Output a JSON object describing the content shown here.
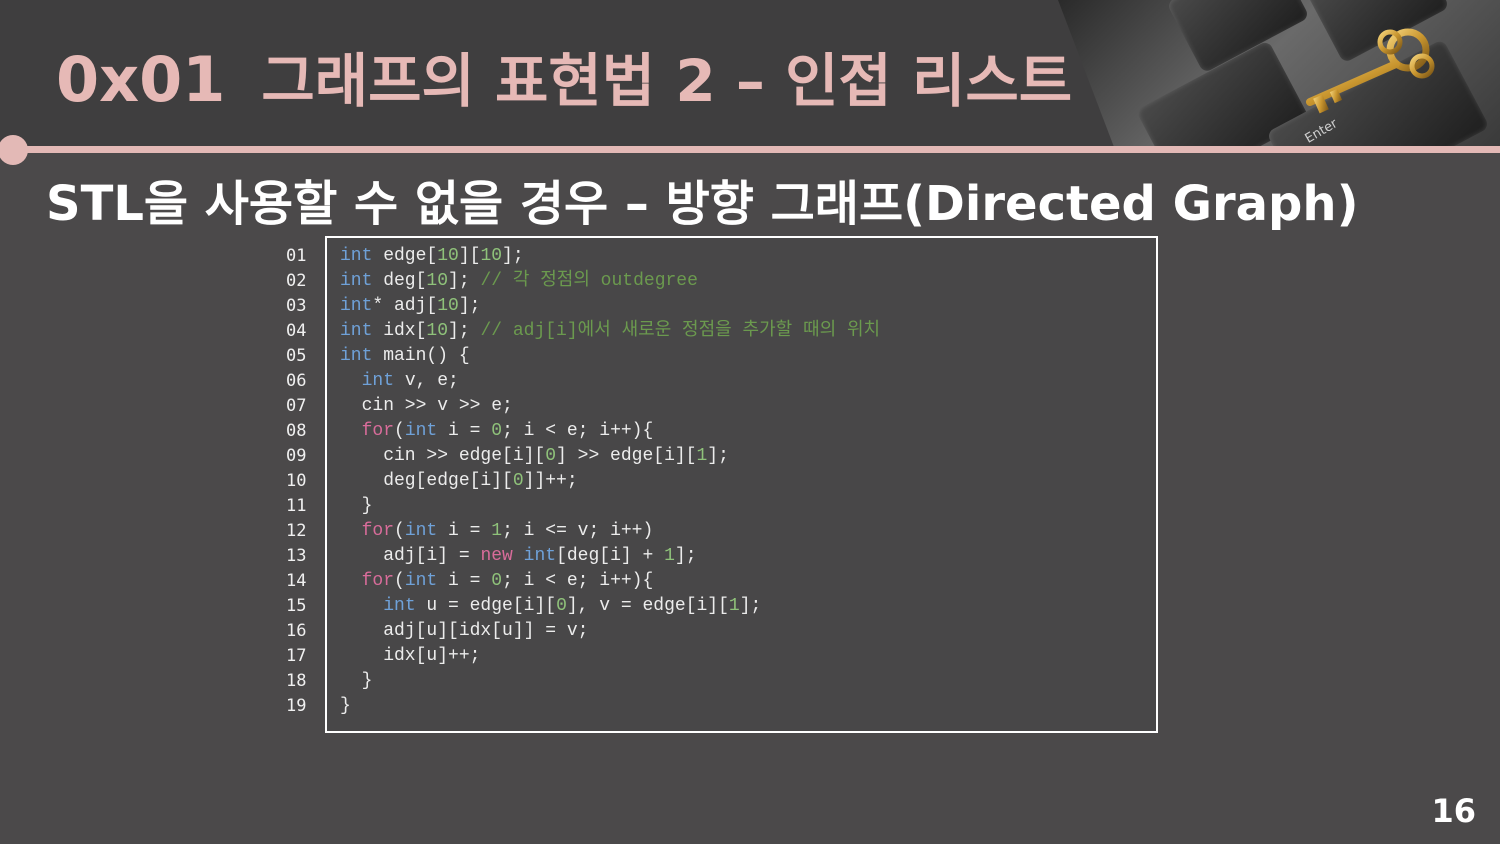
{
  "slide": {
    "number_label": "0x01",
    "title": "그래프의 표현법 2 – 인접 리스트",
    "subtitle": "STL을 사용할 수 없을 경우 – 방향 그래프(Directed Graph)",
    "page_number": "16",
    "accent_color": "#e3b9b6"
  },
  "code": {
    "line_numbers": [
      "01",
      "02",
      "03",
      "04",
      "05",
      "06",
      "07",
      "08",
      "09",
      "10",
      "11",
      "12",
      "13",
      "14",
      "15",
      "16",
      "17",
      "18",
      "19"
    ],
    "lines": [
      [
        [
          "kw",
          "int"
        ],
        [
          "t",
          " edge["
        ],
        [
          "lit",
          "10"
        ],
        [
          "t",
          "]["
        ],
        [
          "lit",
          "10"
        ],
        [
          "t",
          "];"
        ]
      ],
      [
        [
          "kw",
          "int"
        ],
        [
          "t",
          " deg["
        ],
        [
          "lit",
          "10"
        ],
        [
          "t",
          "]; "
        ],
        [
          "cm",
          "// 각 정점의 outdegree"
        ]
      ],
      [
        [
          "kw",
          "int"
        ],
        [
          "t",
          "* adj["
        ],
        [
          "lit",
          "10"
        ],
        [
          "t",
          "];"
        ]
      ],
      [
        [
          "kw",
          "int"
        ],
        [
          "t",
          " idx["
        ],
        [
          "lit",
          "10"
        ],
        [
          "t",
          "]; "
        ],
        [
          "cm",
          "// adj[i]에서 새로운 정점을 추가할 때의 위치"
        ]
      ],
      [
        [
          "kw",
          "int"
        ],
        [
          "t",
          " main() {"
        ]
      ],
      [
        [
          "t",
          "  "
        ],
        [
          "kw",
          "int"
        ],
        [
          "t",
          " v, e;"
        ]
      ],
      [
        [
          "t",
          "  cin >> v >> e;"
        ]
      ],
      [
        [
          "t",
          "  "
        ],
        [
          "ctl",
          "for"
        ],
        [
          "t",
          "("
        ],
        [
          "kw",
          "int"
        ],
        [
          "t",
          " i = "
        ],
        [
          "lit",
          "0"
        ],
        [
          "t",
          "; i < e; i++){"
        ]
      ],
      [
        [
          "t",
          "    cin >> edge[i]["
        ],
        [
          "lit",
          "0"
        ],
        [
          "t",
          "] >> edge[i]["
        ],
        [
          "lit",
          "1"
        ],
        [
          "t",
          "];"
        ]
      ],
      [
        [
          "t",
          "    deg[edge[i]["
        ],
        [
          "lit",
          "0"
        ],
        [
          "t",
          "]]++;"
        ]
      ],
      [
        [
          "t",
          "  }"
        ]
      ],
      [
        [
          "t",
          "  "
        ],
        [
          "ctl",
          "for"
        ],
        [
          "t",
          "("
        ],
        [
          "kw",
          "int"
        ],
        [
          "t",
          " i = "
        ],
        [
          "lit",
          "1"
        ],
        [
          "t",
          "; i <= v; i++)"
        ]
      ],
      [
        [
          "t",
          "    adj[i] = "
        ],
        [
          "ctl",
          "new"
        ],
        [
          "t",
          " "
        ],
        [
          "kw",
          "int"
        ],
        [
          "t",
          "[deg[i] + "
        ],
        [
          "lit",
          "1"
        ],
        [
          "t",
          "];"
        ]
      ],
      [
        [
          "t",
          "  "
        ],
        [
          "ctl",
          "for"
        ],
        [
          "t",
          "("
        ],
        [
          "kw",
          "int"
        ],
        [
          "t",
          " i = "
        ],
        [
          "lit",
          "0"
        ],
        [
          "t",
          "; i < e; i++){"
        ]
      ],
      [
        [
          "t",
          "    "
        ],
        [
          "kw",
          "int"
        ],
        [
          "t",
          " u = edge[i]["
        ],
        [
          "lit",
          "0"
        ],
        [
          "t",
          "], v = edge[i]["
        ],
        [
          "lit",
          "1"
        ],
        [
          "t",
          "];"
        ]
      ],
      [
        [
          "t",
          "    adj[u][idx[u]] = v;"
        ]
      ],
      [
        [
          "t",
          "    idx[u]++;"
        ]
      ],
      [
        [
          "t",
          "  }"
        ]
      ],
      [
        [
          "t",
          "}"
        ]
      ]
    ]
  },
  "keyboard_image": {
    "key_label": "Enter",
    "icon": "golden-key-icon"
  }
}
